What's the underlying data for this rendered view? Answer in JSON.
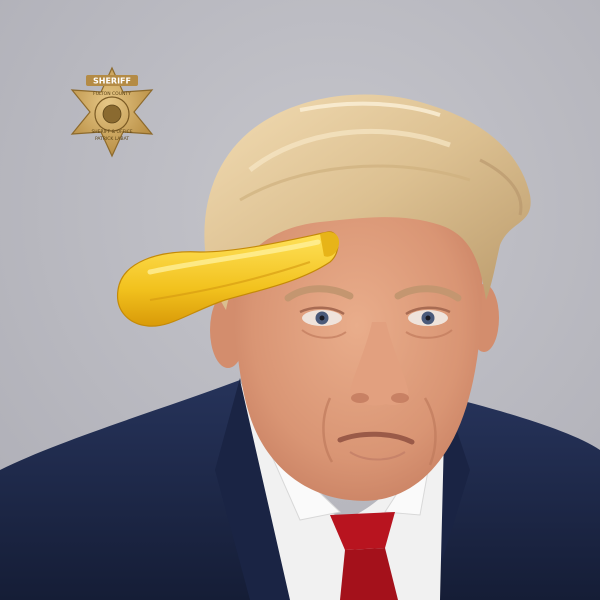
{
  "badge": {
    "top_text": "SHERIFF",
    "ring_text": "FULTON COUNTY",
    "line1": "SHERIFF & OFFICE",
    "line2": "PATRICK LABAT"
  },
  "colors": {
    "background": "#b9b9bf",
    "suit": "#1e2a4a",
    "shirt": "#f3f3f3",
    "tie": "#b8141f",
    "skin": "#e0a07e",
    "hair": "#e3c99d",
    "badge_gold": "#c9a35a",
    "sticker_yellow": "#f2c21e"
  },
  "scene": {
    "background": "plain-gray-wall",
    "subject": "booking-portrait",
    "overlay": "yellow-banana-sticker"
  }
}
